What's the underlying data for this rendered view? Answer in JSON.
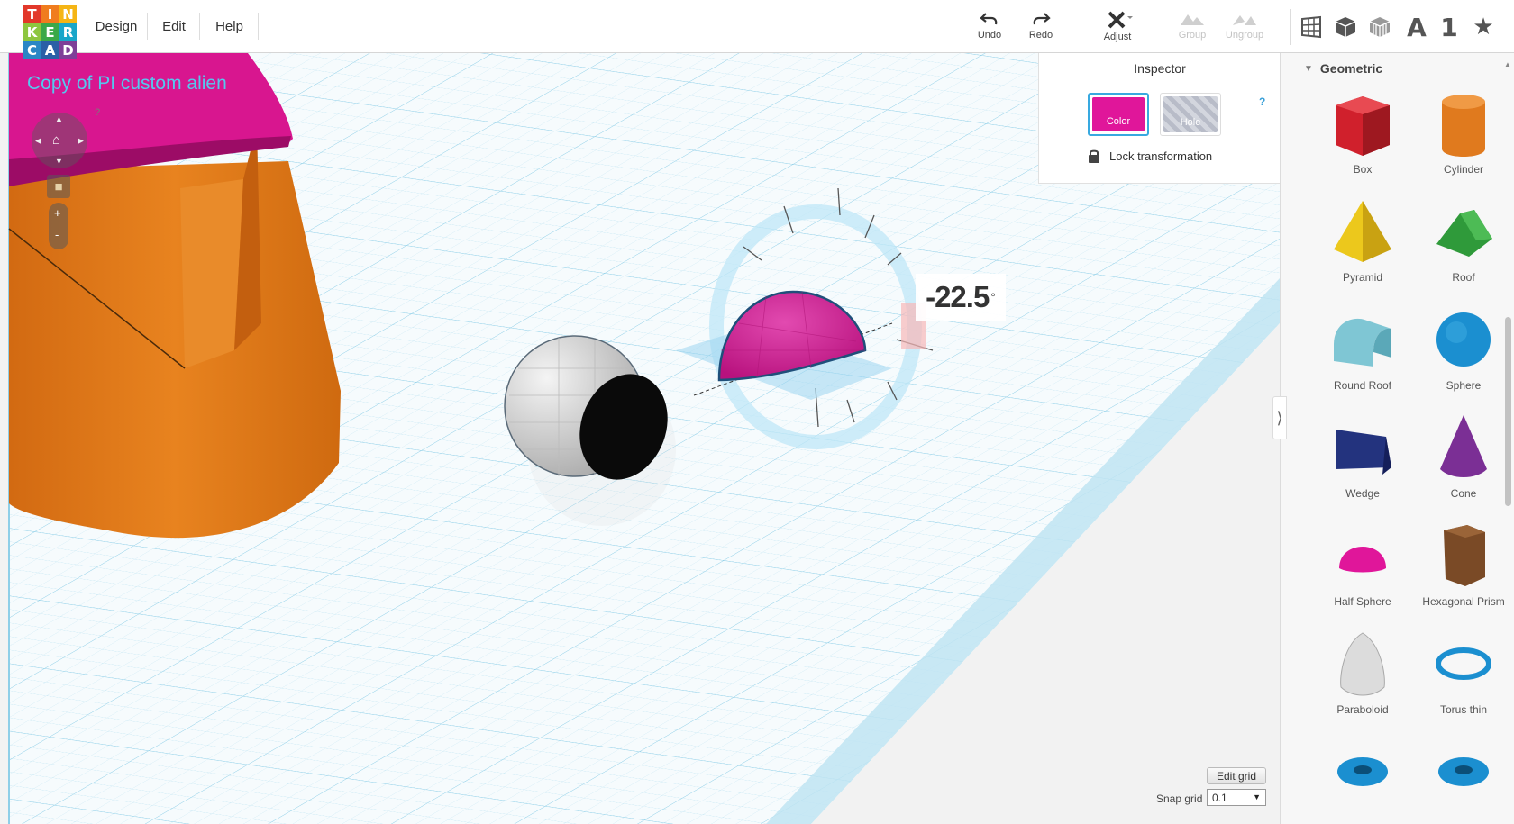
{
  "logo": {
    "letters": [
      "T",
      "I",
      "N",
      "K",
      "E",
      "R",
      "C",
      "A",
      "D"
    ]
  },
  "menu": {
    "design": "Design",
    "edit": "Edit",
    "help": "Help"
  },
  "toolbar": {
    "undo": "Undo",
    "redo": "Redo",
    "adjust": "Adjust",
    "group": "Group",
    "ungroup": "Ungroup",
    "view_text": "A",
    "view_number": "1"
  },
  "project": {
    "title": "Copy of PI custom alien"
  },
  "navigation": {
    "help": "?",
    "zoom_in": "+",
    "zoom_out": "-"
  },
  "rotation": {
    "value": "-22.5",
    "unit": "°"
  },
  "inspector": {
    "title": "Inspector",
    "help": "?",
    "color_label": "Color",
    "hole_label": "Hole",
    "lock_label": "Lock transformation",
    "selected_color": "#e0169a"
  },
  "sidebar_toggle": "⟩",
  "grid": {
    "edit_label": "Edit grid",
    "snap_label": "Snap grid",
    "snap_value": "0.1"
  },
  "library": {
    "category": "Geometric",
    "shapes": [
      {
        "label": "Box",
        "color": "#d0202c"
      },
      {
        "label": "Cylinder",
        "color": "#e07a1e"
      },
      {
        "label": "Pyramid",
        "color": "#ecc81c"
      },
      {
        "label": "Roof",
        "color": "#2f9a3a"
      },
      {
        "label": "Round Roof",
        "color": "#7fc6d4"
      },
      {
        "label": "Sphere",
        "color": "#1b8fd0"
      },
      {
        "label": "Wedge",
        "color": "#23337e"
      },
      {
        "label": "Cone",
        "color": "#7b2f95"
      },
      {
        "label": "Half Sphere",
        "color": "#e0169a"
      },
      {
        "label": "Hexagonal Prism",
        "color": "#7a4a26"
      },
      {
        "label": "Paraboloid",
        "color": "#dcdcdc"
      },
      {
        "label": "Torus thin",
        "color": "#1b8fd0"
      },
      {
        "label": "",
        "color": "#1b8fd0"
      },
      {
        "label": "",
        "color": "#1b8fd0"
      }
    ]
  },
  "colors": {
    "accent": "#38a9e0",
    "workplane_grid": "#aadcf0",
    "title_text": "#55c8ee"
  }
}
